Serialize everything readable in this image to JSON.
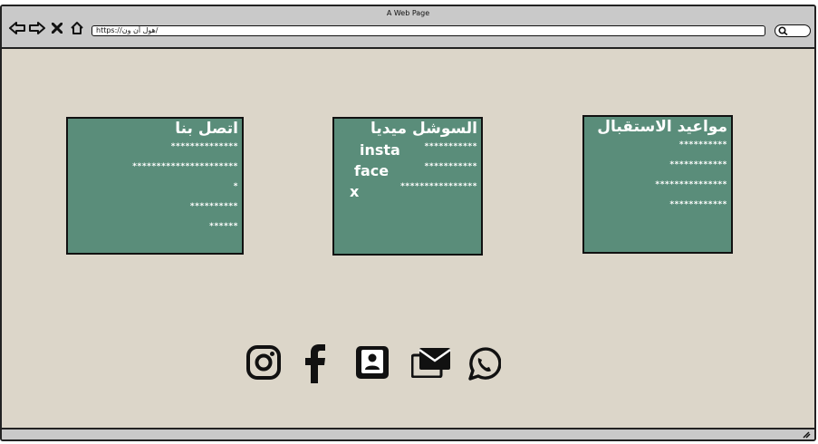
{
  "window": {
    "title": "A Web Page"
  },
  "address_bar": {
    "url": "https://هول أن ون/"
  },
  "cards": {
    "contact": {
      "title": "اتصل بنا",
      "lines": [
        "**************",
        "**********************",
        "*",
        "**********",
        "******"
      ]
    },
    "social": {
      "title": "السوشل ميديا",
      "labels": [
        "insta",
        "face",
        "x"
      ],
      "lines": [
        "***********",
        "***********",
        "****************"
      ]
    },
    "hours": {
      "title": "مواعيد الاستقبال",
      "lines": [
        "**********",
        "************",
        "***************",
        "************"
      ]
    }
  },
  "footer": {
    "icons": [
      "instagram-icon",
      "facebook-icon",
      "contact-card-icon",
      "mail-icon",
      "whatsapp-icon"
    ]
  },
  "colors": {
    "page_bg": "#dcd6c9",
    "card_bg": "#5a8d7a",
    "chrome_bg": "#c9c9c9"
  }
}
